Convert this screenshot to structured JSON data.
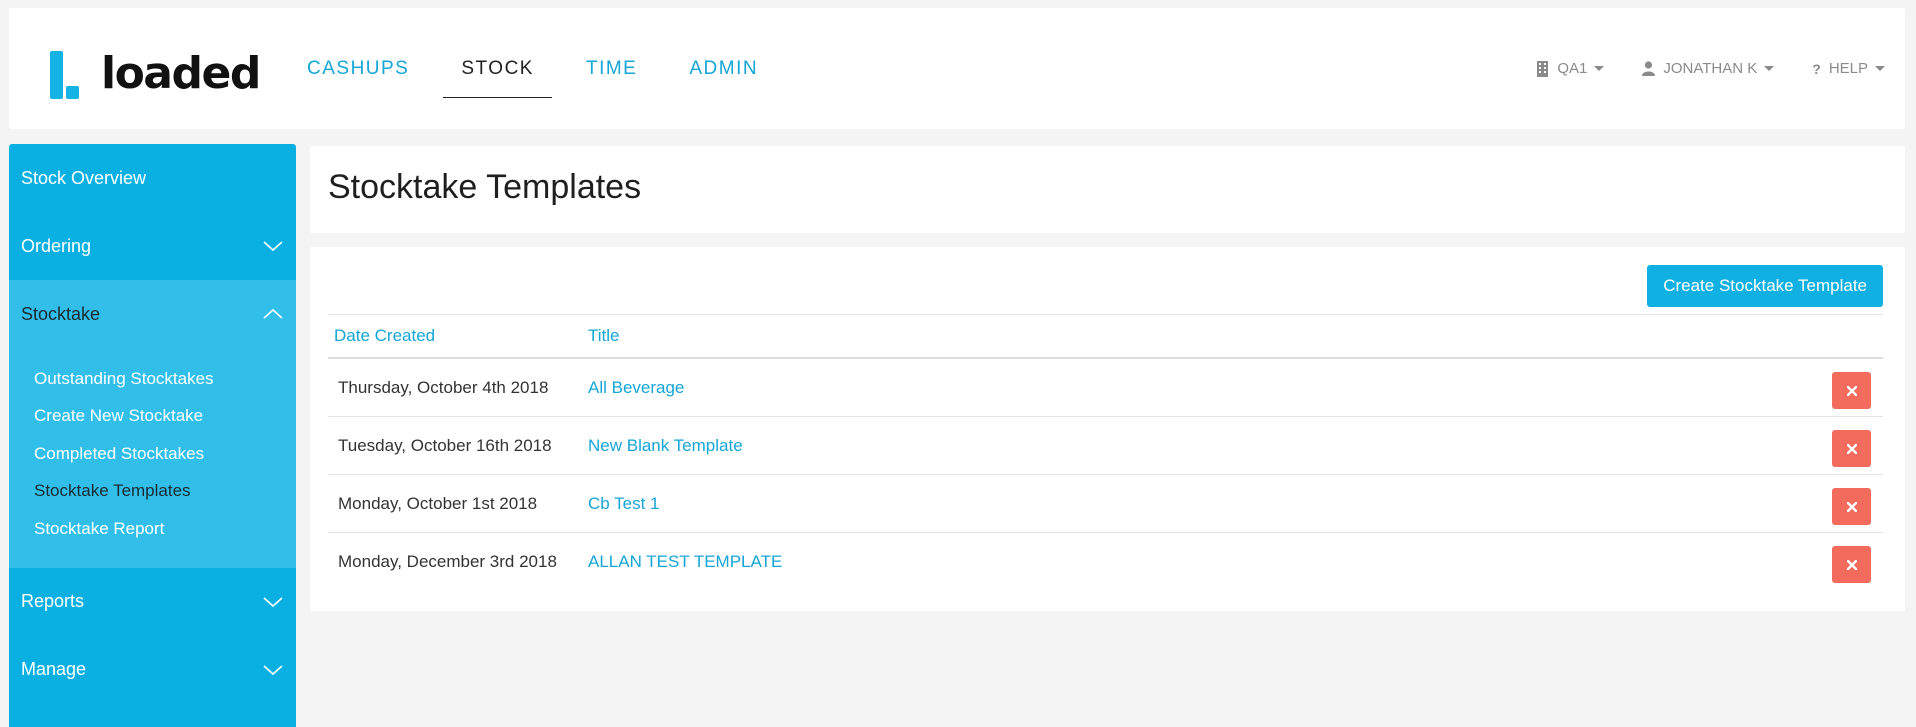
{
  "brand": {
    "logo_text": "loaded",
    "accent": "#09b0e1",
    "danger": "#f26b5d"
  },
  "nav": {
    "items": [
      {
        "label": "CASHUPS",
        "active": false
      },
      {
        "label": "STOCK",
        "active": true
      },
      {
        "label": "TIME",
        "active": false
      },
      {
        "label": "ADMIN",
        "active": false
      }
    ]
  },
  "topright": {
    "venue": "QA1",
    "user": "JONATHAN K",
    "help": "HELP"
  },
  "sidebar": {
    "stock_overview": "Stock Overview",
    "ordering": "Ordering",
    "stocktake": "Stocktake",
    "stocktake_items": [
      "Outstanding Stocktakes",
      "Create New Stocktake",
      "Completed Stocktakes",
      "Stocktake Templates",
      "Stocktake Report"
    ],
    "reports": "Reports",
    "manage": "Manage"
  },
  "page": {
    "title": "Stocktake Templates",
    "create_button": "Create Stocktake Template"
  },
  "table": {
    "columns": [
      "Date Created",
      "Title"
    ],
    "rows": [
      {
        "date": "Thursday, October 4th 2018",
        "title": "All Beverage"
      },
      {
        "date": "Tuesday, October 16th 2018",
        "title": "New Blank Template"
      },
      {
        "date": "Monday, October 1st 2018",
        "title": "Cb Test 1"
      },
      {
        "date": "Monday, December 3rd 2018",
        "title": "ALLAN TEST TEMPLATE"
      }
    ]
  }
}
